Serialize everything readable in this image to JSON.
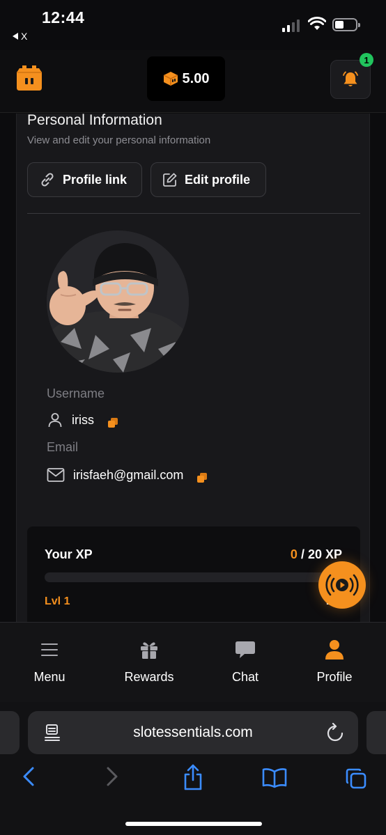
{
  "status_bar": {
    "time": "12:44",
    "back_app": "X"
  },
  "header": {
    "balance": "5.00",
    "notification_count": "1"
  },
  "profile_section": {
    "title": "Personal Information",
    "subtitle": "View and edit your personal information",
    "profile_link_label": "Profile link",
    "edit_profile_label": "Edit profile",
    "username_label": "Username",
    "username": "iriss",
    "email_label": "Email",
    "email": "irisfaeh@gmail.com"
  },
  "xp": {
    "title": "Your XP",
    "current": "0",
    "separator": " / ",
    "target": "20 XP",
    "progress": 0,
    "level_current": "Lvl 1",
    "level_next": "Lvl"
  },
  "bottom_nav": {
    "items": [
      {
        "label": "Menu",
        "icon": "menu-icon"
      },
      {
        "label": "Rewards",
        "icon": "gift-icon"
      },
      {
        "label": "Chat",
        "icon": "chat-icon"
      },
      {
        "label": "Profile",
        "icon": "user-icon",
        "active": true
      }
    ]
  },
  "browser": {
    "url": "slotessentials.com"
  },
  "colors": {
    "accent": "#f5901e",
    "badge": "#21c45d",
    "panel": "#18181b",
    "background": "#0c0c0e"
  }
}
